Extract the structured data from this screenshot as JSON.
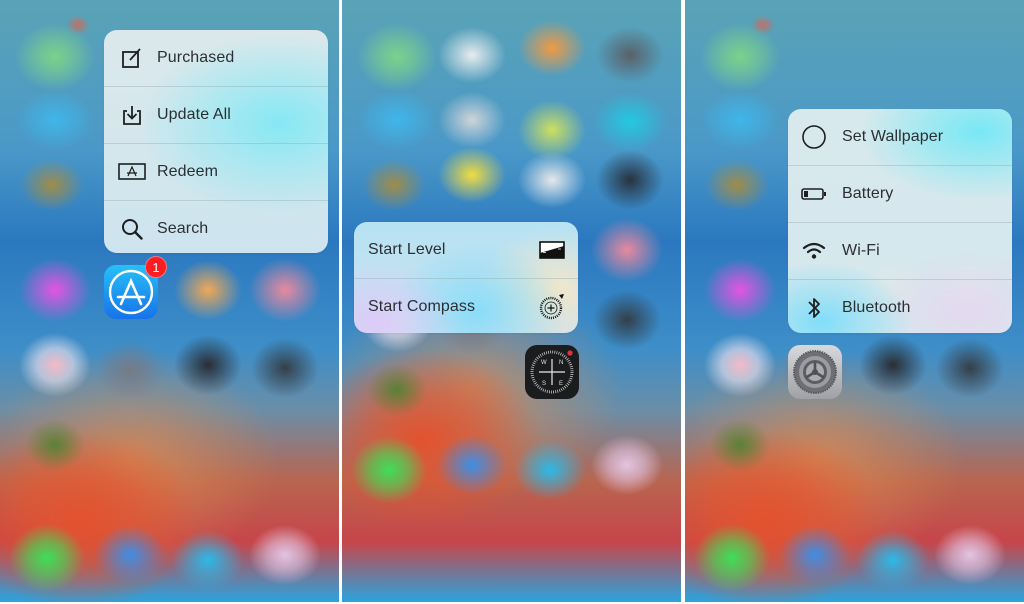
{
  "panels": [
    {
      "app": "App Store",
      "app_icon": "app-store-icon",
      "badge_count": "1",
      "menu": [
        {
          "label": "Purchased",
          "icon": "purchased-icon"
        },
        {
          "label": "Update All",
          "icon": "download-icon"
        },
        {
          "label": "Redeem",
          "icon": "redeem-card-icon"
        },
        {
          "label": "Search",
          "icon": "search-icon"
        }
      ]
    },
    {
      "app": "Compass",
      "app_icon": "compass-app-icon",
      "compass_letters": {
        "n": "N",
        "s": "S",
        "e": "E",
        "w": "W"
      },
      "menu": [
        {
          "label": "Start Level",
          "icon": "level-icon"
        },
        {
          "label": "Start Compass",
          "icon": "compass-icon"
        }
      ]
    },
    {
      "app": "Settings",
      "app_icon": "settings-gear-icon",
      "menu": [
        {
          "label": "Set Wallpaper",
          "icon": "wallpaper-circle-icon"
        },
        {
          "label": "Battery",
          "icon": "battery-icon"
        },
        {
          "label": "Wi-Fi",
          "icon": "wifi-icon"
        },
        {
          "label": "Bluetooth",
          "icon": "bluetooth-icon"
        }
      ]
    }
  ],
  "colors": {
    "badge": "#fc1d23",
    "app_store_top": "#27c0f8",
    "app_store_bottom": "#1673e9",
    "menu_text": "#2b2f33"
  }
}
